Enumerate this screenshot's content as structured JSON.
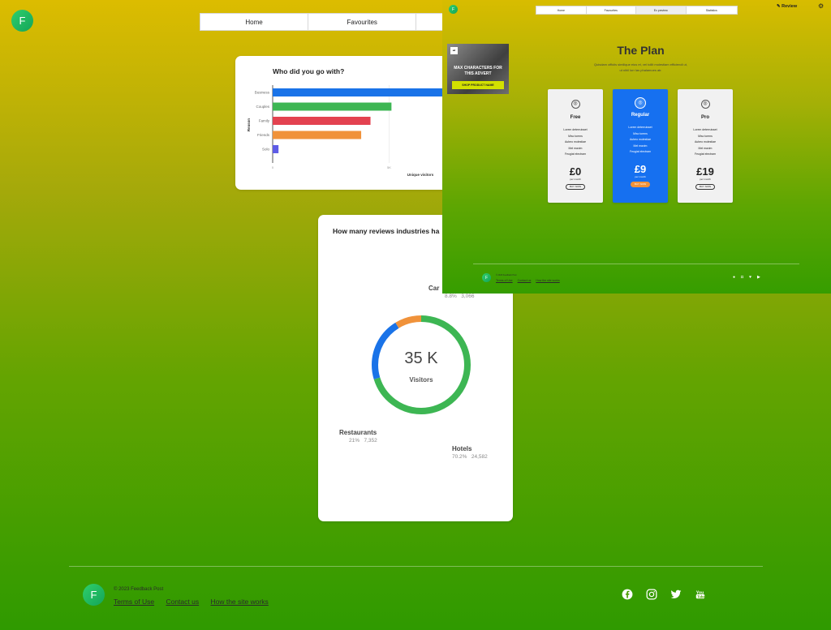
{
  "nav": {
    "items": [
      "Home",
      "Favourites"
    ]
  },
  "bar_chart": {
    "title": "Who did you go with?",
    "chart_data": {
      "type": "bar",
      "title": "Who did you go with?",
      "orientation": "horizontal",
      "categories": [
        "Business",
        "Couples",
        "Family",
        "Friends",
        "Solo"
      ],
      "values": [
        8100,
        5100,
        4200,
        3800,
        250
      ],
      "colors": [
        "#1a73e8",
        "#3db653",
        "#e34250",
        "#f0923a",
        "#5e5ce6"
      ],
      "xlabel": "Unique visitors",
      "ylabel": "Reason",
      "xticks": [
        "0",
        "5K",
        "10K"
      ],
      "xlim": [
        0,
        10000
      ]
    }
  },
  "donut_chart": {
    "title": "How many reviews industries ha",
    "center_value": "35 K",
    "center_label": "Visitors",
    "chart_data": {
      "type": "pie",
      "title": "How many reviews industries ha",
      "series": [
        {
          "name": "Car",
          "percent": 8.8,
          "count": 3066,
          "pct_text": "8.8%",
          "count_text": "3,066",
          "color": "#f0923a"
        },
        {
          "name": "Restaurants",
          "percent": 21,
          "count": 7352,
          "pct_text": "21%",
          "count_text": "7,352",
          "color": "#1a73e8"
        },
        {
          "name": "Hotels",
          "percent": 70.2,
          "count": 24582,
          "pct_text": "70.2%",
          "count_text": "24,582",
          "color": "#3db653"
        }
      ]
    }
  },
  "footer": {
    "copyright": "© 2023 Feedback Post",
    "links": [
      "Terms of Use",
      "Contact us",
      "How the site works"
    ],
    "social_icons": [
      "facebook-icon",
      "instagram-icon",
      "twitter-icon",
      "youtube-icon"
    ]
  },
  "overlay": {
    "nav": [
      "Home",
      "Favourites",
      "Ex preview",
      "Statistics"
    ],
    "review_label": "Review",
    "ad": {
      "headline": "MAX CHARACTERS FOR THIS ADVERT",
      "cta": "SHOP PRODUCT NAME",
      "logo_text": "ad"
    },
    "plan_title": "The Plan",
    "plan_subtitle_1": "Quisdam officiis similique eius et, vel tollit molestiam efficiendi ut,",
    "plan_subtitle_2": "ut nihil lorr las phalamoes atr.",
    "plans": [
      {
        "name": "Free",
        "price": "£0",
        "period": "per month",
        "button": "BUY NOW",
        "features": [
          "Lorem deterruisset",
          "Misc toems",
          "Aubeo molestiae",
          "Mel maxim",
          "Feugiat electram"
        ]
      },
      {
        "name": "Regular",
        "price": "£9",
        "period": "per month",
        "button": "BUY NOW",
        "features": [
          "Lorem deterruisset",
          "Misc toems",
          "Aubeo molestiae",
          "Mel maxim",
          "Feugiat electram"
        ]
      },
      {
        "name": "Pro",
        "price": "£19",
        "period": "per month",
        "button": "BUY NOW",
        "features": [
          "Lorem deterruisset",
          "Misc toems",
          "Aubeo molestiae",
          "Mel maxim",
          "Feugiat electram"
        ]
      }
    ],
    "footer_copyright": "© 2023 Feedback Post",
    "footer_links": [
      "Terms of Use",
      "Contact us",
      "How the site works"
    ]
  }
}
